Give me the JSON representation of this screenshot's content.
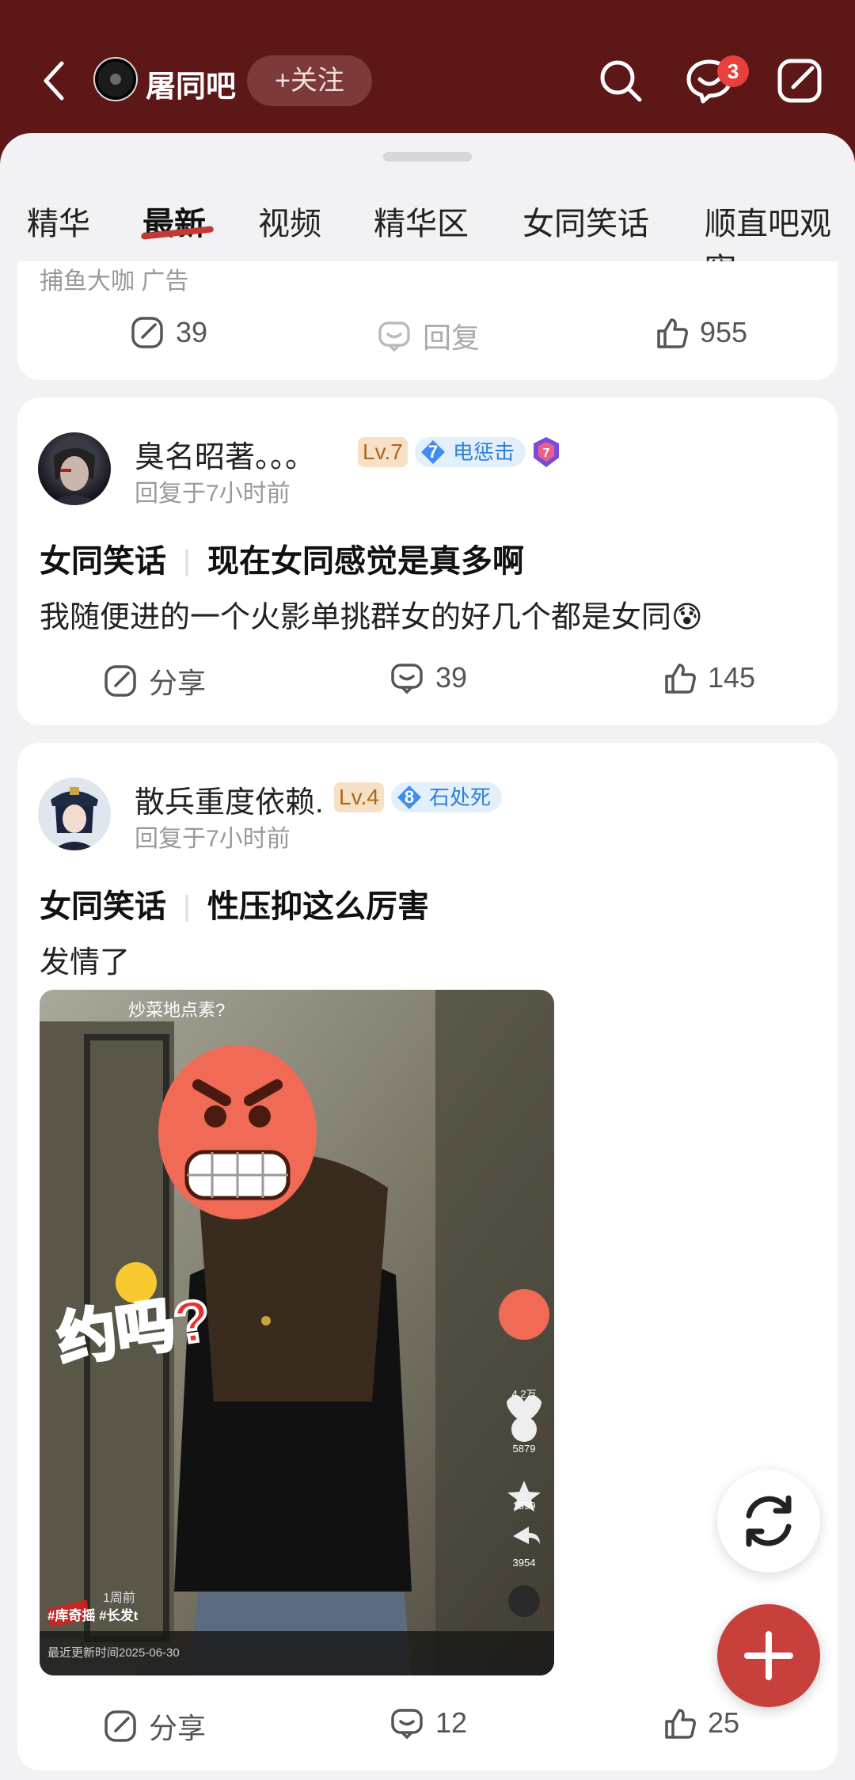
{
  "header": {
    "forum_name": "屠同吧",
    "follow_label": "+关注",
    "notification_count": "3"
  },
  "tabs": [
    "精华",
    "最新",
    "视频",
    "精华区",
    "女同笑话",
    "顺直吧观察"
  ],
  "active_tab": "最新",
  "ad_card": {
    "source": "捕鱼大咖  广告",
    "share_count": "39",
    "reply_label": "回复",
    "like_count": "955"
  },
  "posts": [
    {
      "username": "臭名昭著。。。",
      "level": "Lv.7",
      "badge_level": "7",
      "badge_title": "电惩击",
      "time": "回复于7小时前",
      "category": "女同笑话",
      "title": "现在女同感觉是真多啊",
      "body": "我随便进的一个火影单挑群女的好几个都是女同😰",
      "share_label": "分享",
      "comment_count": "39",
      "like_count": "145"
    },
    {
      "username": "散兵重度依赖.",
      "level": "Lv.4",
      "badge_level": "8",
      "badge_title": "石处死",
      "time": "回复于7小时前",
      "category": "女同笑话",
      "title": "性压抑这么厉害",
      "body": "发情了",
      "image": {
        "top_caption": "炒菜地点素?",
        "sticker_text": "约吗?",
        "likes": "4.2万",
        "comments": "5879",
        "favorites": "1599",
        "shares": "3954",
        "tags": "#库奇摇 #长发t",
        "week_label": "1周前",
        "update_time": "最近更新时间2025-06-30"
      },
      "share_label": "分享",
      "comment_count": "12",
      "like_count": "25"
    }
  ],
  "colors": {
    "header_bg": "#5d1717",
    "accent": "#c8403b",
    "badge_blue": "#2f7fd8"
  }
}
